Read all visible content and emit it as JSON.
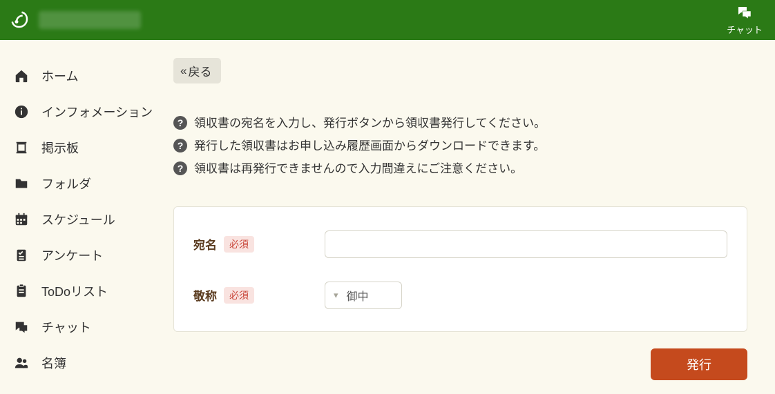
{
  "header": {
    "chat_label": "チャット"
  },
  "sidebar": {
    "items": [
      {
        "label": "ホーム",
        "name": "sidebar-item-home",
        "icon": "home-icon"
      },
      {
        "label": "インフォメーション",
        "name": "sidebar-item-information",
        "icon": "info-icon"
      },
      {
        "label": "掲示板",
        "name": "sidebar-item-board",
        "icon": "board-icon"
      },
      {
        "label": "フォルダ",
        "name": "sidebar-item-folder",
        "icon": "folder-icon"
      },
      {
        "label": "スケジュール",
        "name": "sidebar-item-schedule",
        "icon": "calendar-icon"
      },
      {
        "label": "アンケート",
        "name": "sidebar-item-survey",
        "icon": "survey-icon"
      },
      {
        "label": "ToDoリスト",
        "name": "sidebar-item-todo",
        "icon": "clipboard-icon"
      },
      {
        "label": "チャット",
        "name": "sidebar-item-chat",
        "icon": "chat-icon"
      },
      {
        "label": "名簿",
        "name": "sidebar-item-members",
        "icon": "members-icon"
      }
    ]
  },
  "content": {
    "back_label": "戻る",
    "instructions": [
      "領収書の宛名を入力し、発行ボタンから領収書発行してください。",
      "発行した領収書はお申し込み履歴画面からダウンロードできます。",
      "領収書は再発行できませんので入力間違えにご注意ください。"
    ],
    "form": {
      "required_label": "必須",
      "rows": [
        {
          "label": "宛名",
          "type": "text",
          "value": ""
        },
        {
          "label": "敬称",
          "type": "select",
          "value": "御中"
        }
      ]
    },
    "submit_label": "発行"
  },
  "colors": {
    "brand_green": "#2b7a16",
    "accent_orange": "#c54a1d",
    "bg": "#fbf9ee"
  }
}
